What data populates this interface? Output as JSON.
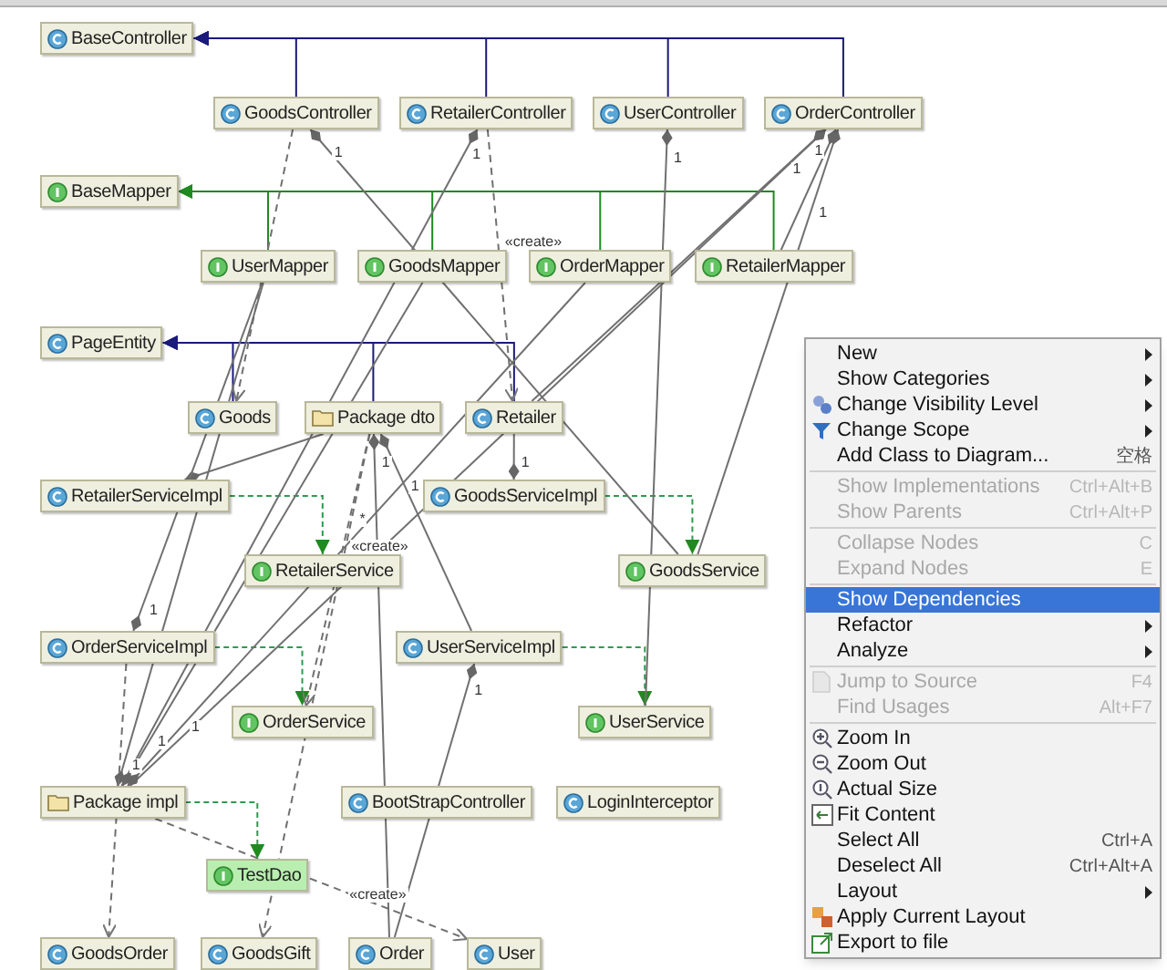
{
  "diagram": {
    "nodes": [
      {
        "label": "BaseController",
        "kind": "class",
        "selected": false
      },
      {
        "label": "GoodsController",
        "kind": "class",
        "selected": false
      },
      {
        "label": "RetailerController",
        "kind": "class",
        "selected": false
      },
      {
        "label": "UserController",
        "kind": "class",
        "selected": false
      },
      {
        "label": "OrderController",
        "kind": "class",
        "selected": false
      },
      {
        "label": "BaseMapper",
        "kind": "interface",
        "selected": false
      },
      {
        "label": "UserMapper",
        "kind": "interface",
        "selected": false
      },
      {
        "label": "GoodsMapper",
        "kind": "interface",
        "selected": false
      },
      {
        "label": "OrderMapper",
        "kind": "interface",
        "selected": false
      },
      {
        "label": "RetailerMapper",
        "kind": "interface",
        "selected": false
      },
      {
        "label": "PageEntity",
        "kind": "class",
        "selected": false
      },
      {
        "label": "Goods",
        "kind": "class",
        "selected": false
      },
      {
        "label": "Package dto",
        "kind": "package",
        "selected": false
      },
      {
        "label": "Retailer",
        "kind": "class",
        "selected": false
      },
      {
        "label": "RetailerServiceImpl",
        "kind": "class",
        "selected": false
      },
      {
        "label": "GoodsServiceImpl",
        "kind": "class",
        "selected": false
      },
      {
        "label": "RetailerService",
        "kind": "interface",
        "selected": false
      },
      {
        "label": "GoodsService",
        "kind": "interface",
        "selected": false
      },
      {
        "label": "OrderServiceImpl",
        "kind": "class",
        "selected": false
      },
      {
        "label": "UserServiceImpl",
        "kind": "class",
        "selected": false
      },
      {
        "label": "OrderService",
        "kind": "interface",
        "selected": false
      },
      {
        "label": "UserService",
        "kind": "interface",
        "selected": false
      },
      {
        "label": "Package impl",
        "kind": "package",
        "selected": false
      },
      {
        "label": "BootStrapController",
        "kind": "class",
        "selected": false
      },
      {
        "label": "LoginInterceptor",
        "kind": "class",
        "selected": false
      },
      {
        "label": "TestDao",
        "kind": "interface",
        "selected": true
      },
      {
        "label": "GoodsOrder",
        "kind": "class",
        "selected": false
      },
      {
        "label": "GoodsGift",
        "kind": "class",
        "selected": false
      },
      {
        "label": "Order",
        "kind": "class",
        "selected": false
      },
      {
        "label": "User",
        "kind": "class",
        "selected": false
      }
    ],
    "edges": [
      {
        "kind": "extends"
      },
      {
        "kind": "extends"
      },
      {
        "kind": "extends"
      },
      {
        "kind": "extends"
      },
      {
        "kind": "extends"
      },
      {
        "kind": "extends"
      },
      {
        "kind": "extends"
      },
      {
        "kind": "extends"
      },
      {
        "kind": "extends"
      },
      {
        "kind": "extends"
      },
      {
        "kind": "extends"
      },
      {
        "kind": "implements"
      },
      {
        "kind": "implements"
      },
      {
        "kind": "implements"
      },
      {
        "kind": "implements"
      },
      {
        "kind": "implements"
      },
      {
        "kind": "association",
        "label": "1"
      },
      {
        "kind": "association",
        "label": "1"
      },
      {
        "kind": "association",
        "label": "1"
      },
      {
        "kind": "association",
        "label": "1"
      },
      {
        "kind": "association",
        "label": "1"
      },
      {
        "kind": "association"
      },
      {
        "kind": "association",
        "label": "1"
      },
      {
        "kind": "association",
        "label": "1"
      },
      {
        "kind": "association",
        "label": "1"
      },
      {
        "kind": "association",
        "label": "1"
      },
      {
        "kind": "association",
        "label": "1"
      },
      {
        "kind": "association",
        "label": "1"
      },
      {
        "kind": "association",
        "label": "1"
      },
      {
        "kind": "association",
        "label": "1"
      },
      {
        "kind": "association"
      },
      {
        "kind": "association",
        "label": "1"
      },
      {
        "kind": "dependency"
      },
      {
        "kind": "dependency",
        "label": "«create»"
      },
      {
        "kind": "dependency"
      },
      {
        "kind": "dependency",
        "label": "*"
      },
      {
        "kind": "dependency",
        "label": "«create»"
      },
      {
        "kind": "dependency",
        "label": "«create»"
      }
    ]
  },
  "context_menu": {
    "items": [
      {
        "kind": "item",
        "label": "New",
        "submenu": true,
        "disabled": false,
        "selected": false
      },
      {
        "kind": "item",
        "label": "Show Categories",
        "submenu": true,
        "disabled": false,
        "selected": false
      },
      {
        "kind": "item",
        "label": "Change Visibility Level",
        "submenu": true,
        "disabled": false,
        "selected": false
      },
      {
        "kind": "item",
        "label": "Change Scope",
        "submenu": true,
        "disabled": false,
        "selected": false
      },
      {
        "kind": "item",
        "label": "Add Class to Diagram...",
        "shortcut": "空格",
        "submenu": false,
        "disabled": false,
        "selected": false
      },
      {
        "kind": "separator"
      },
      {
        "kind": "item",
        "label": "Show Implementations",
        "shortcut": "Ctrl+Alt+B",
        "submenu": false,
        "disabled": true,
        "selected": false
      },
      {
        "kind": "item",
        "label": "Show Parents",
        "shortcut": "Ctrl+Alt+P",
        "submenu": false,
        "disabled": true,
        "selected": false
      },
      {
        "kind": "separator"
      },
      {
        "kind": "item",
        "label": "Collapse Nodes",
        "shortcut": "C",
        "submenu": false,
        "disabled": true,
        "selected": false
      },
      {
        "kind": "item",
        "label": "Expand Nodes",
        "shortcut": "E",
        "submenu": false,
        "disabled": true,
        "selected": false
      },
      {
        "kind": "separator"
      },
      {
        "kind": "item",
        "label": "Show Dependencies",
        "submenu": false,
        "disabled": false,
        "selected": true
      },
      {
        "kind": "item",
        "label": "Refactor",
        "submenu": true,
        "disabled": false,
        "selected": false
      },
      {
        "kind": "item",
        "label": "Analyze",
        "submenu": true,
        "disabled": false,
        "selected": false
      },
      {
        "kind": "separator"
      },
      {
        "kind": "item",
        "label": "Jump to Source",
        "shortcut": "F4",
        "submenu": false,
        "disabled": true,
        "selected": false
      },
      {
        "kind": "item",
        "label": "Find Usages",
        "shortcut": "Alt+F7",
        "submenu": false,
        "disabled": true,
        "selected": false
      },
      {
        "kind": "separator"
      },
      {
        "kind": "item",
        "label": "Zoom In",
        "submenu": false,
        "disabled": false,
        "selected": false
      },
      {
        "kind": "item",
        "label": "Zoom Out",
        "submenu": false,
        "disabled": false,
        "selected": false
      },
      {
        "kind": "item",
        "label": "Actual Size",
        "submenu": false,
        "disabled": false,
        "selected": false
      },
      {
        "kind": "item",
        "label": "Fit Content",
        "submenu": false,
        "disabled": false,
        "selected": false
      },
      {
        "kind": "item",
        "label": "Select All",
        "shortcut": "Ctrl+A",
        "submenu": false,
        "disabled": false,
        "selected": false
      },
      {
        "kind": "item",
        "label": "Deselect All",
        "shortcut": "Ctrl+Alt+A",
        "submenu": false,
        "disabled": false,
        "selected": false
      },
      {
        "kind": "item",
        "label": "Layout",
        "submenu": true,
        "disabled": false,
        "selected": false
      },
      {
        "kind": "item",
        "label": "Apply Current Layout",
        "submenu": false,
        "disabled": false,
        "selected": false
      },
      {
        "kind": "item",
        "label": "Export to file",
        "submenu": false,
        "disabled": false,
        "selected": false
      }
    ]
  }
}
